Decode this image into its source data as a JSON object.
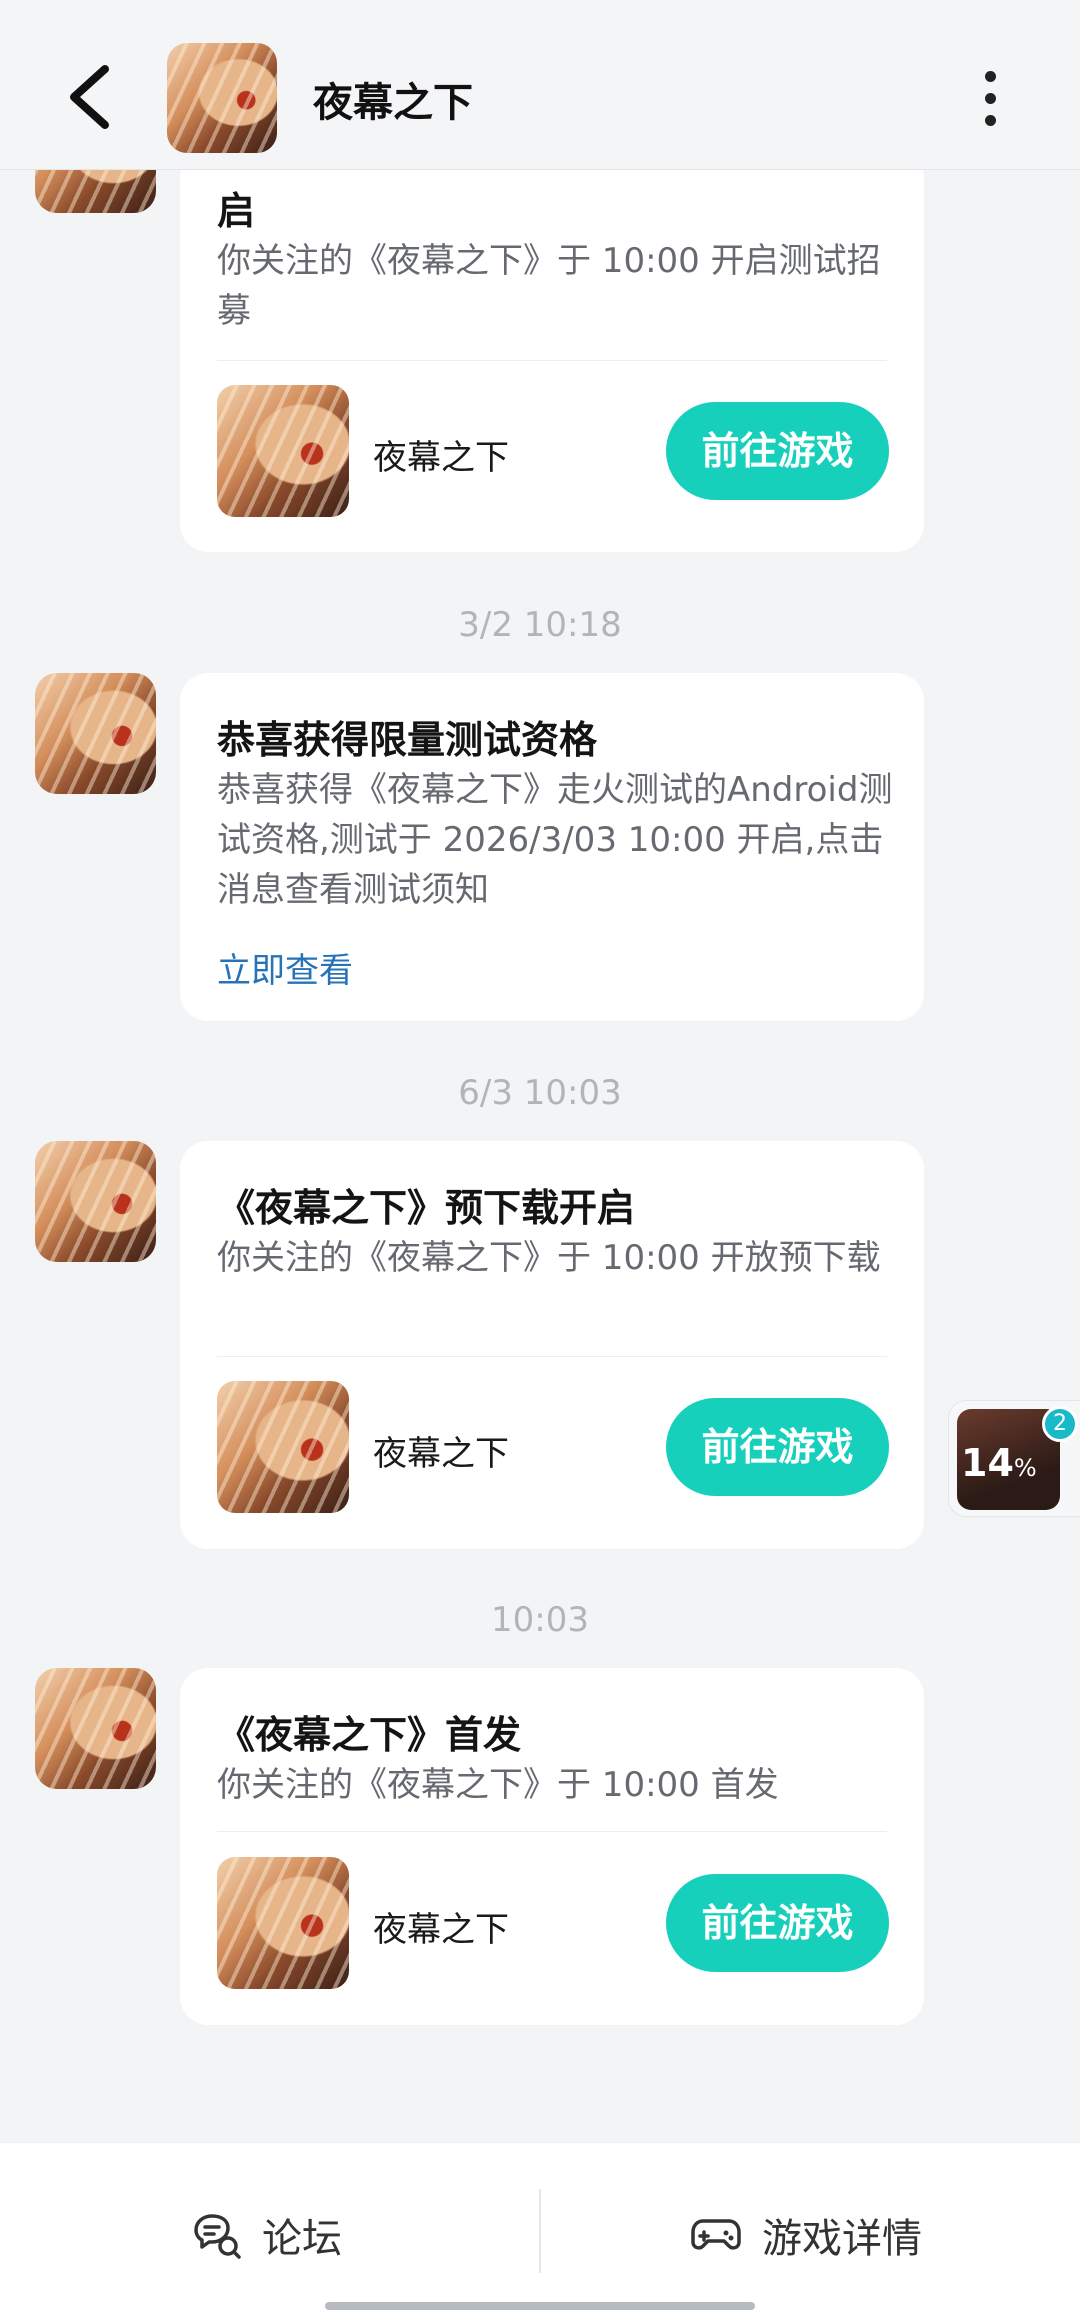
{
  "header": {
    "title": "夜幕之下",
    "back_icon": "chevron-left-icon",
    "more_icon": "more-vertical-icon"
  },
  "messages": [
    {
      "title_partial": "启",
      "body": "你关注的《夜幕之下》于 10:00 开启测试招募",
      "game_name": "夜幕之下",
      "button": "前往游戏"
    },
    {
      "timestamp": "3/2  10:18",
      "title": "恭喜获得限量测试资格",
      "body": "恭喜获得《夜幕之下》走火测试的Android测试资格,测试于 2026/3/03 10:00 开启,点击消息查看测试须知",
      "link": "立即查看"
    },
    {
      "timestamp": "6/3  10:03",
      "title": "《夜幕之下》预下载开启",
      "body": "你关注的《夜幕之下》于 10:00 开放预下载",
      "game_name": "夜幕之下",
      "button": "前往游戏"
    },
    {
      "timestamp": "10:03",
      "title": "《夜幕之下》首发",
      "body": "你关注的《夜幕之下》于 10:00 首发",
      "game_name": "夜幕之下",
      "button": "前往游戏"
    }
  ],
  "float_widget": {
    "percent": "14",
    "percent_sign": "%",
    "badge": "2"
  },
  "bottom_bar": {
    "forum": "论坛",
    "game_detail": "游戏详情"
  },
  "colors": {
    "accent": "#16d0bc",
    "link": "#2773b8",
    "background": "#f3f4f6"
  }
}
